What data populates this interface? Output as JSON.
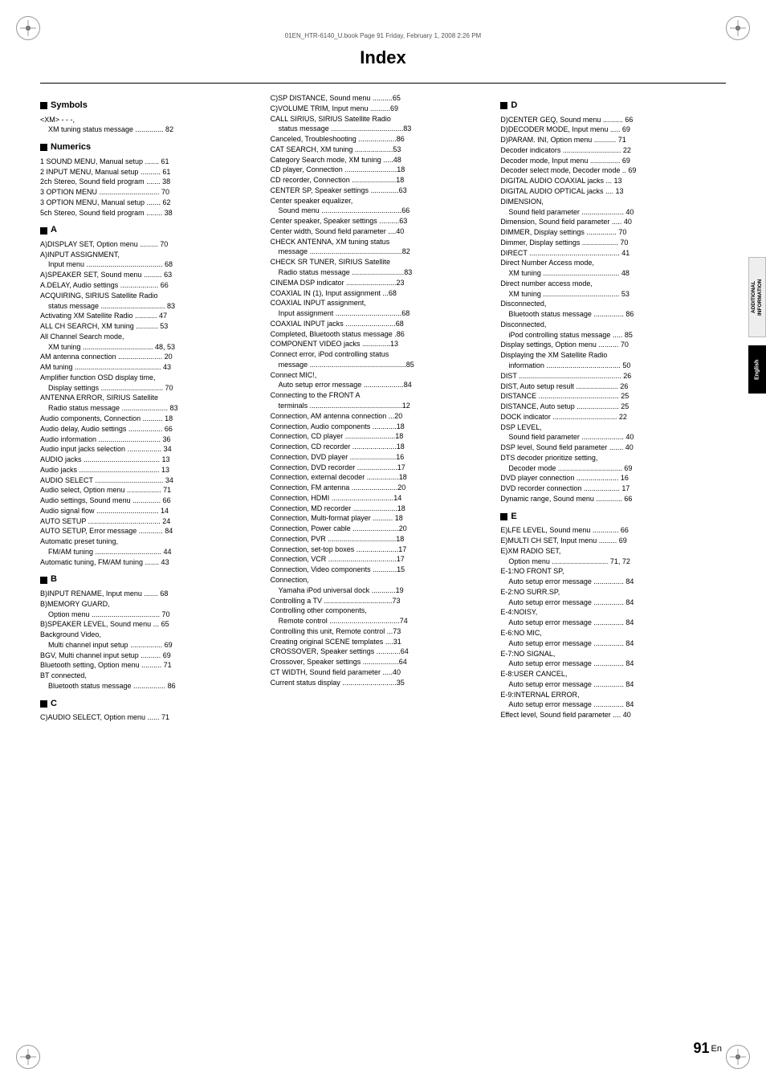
{
  "page": {
    "title": "Index",
    "file_info": "01EN_HTR-6140_U.book  Page 91  Friday, February 1, 2008  2:26 PM",
    "page_number": "91",
    "page_lang": "En"
  },
  "side_tabs": {
    "additional_info": "ADDITIONAL\nINFORMATION",
    "english": "English"
  },
  "columns": {
    "col1": {
      "sections": [
        {
          "header": "Symbols",
          "entries": [
            "<XM> - - -,",
            "  XM tuning status message .............. 82"
          ]
        },
        {
          "header": "Numerics",
          "entries": [
            "1 SOUND MENU, Manual setup ....... 61",
            "2 INPUT MENU, Manual setup .......... 61",
            "2ch Stereo, Sound field program ....... 38",
            "3 OPTION MENU .............................. 70",
            "3 OPTION MENU, Manual setup ....... 62",
            "5ch Stereo, Sound field program ........ 38"
          ]
        },
        {
          "header": "A",
          "entries": [
            "A)DISPLAY SET, Option menu ......... 70",
            "A)INPUT ASSIGNMENT,",
            "  Input menu ...................................... 68",
            "A)SPEAKER SET, Sound menu ......... 63",
            "A.DELAY, Audio settings ..................... 66",
            "ACQUIRING, SIRIUS Satellite Radio",
            "  status message ................................ 83",
            "Activating XM Satellite Radio ........... 47",
            "ALL CH SEARCH, XM tuning ........... 53",
            "All Channel Search mode,",
            "  XM tuning ................................... 48, 53",
            "AM antenna connection ...................... 20",
            "AM tuning ........................................... 43",
            "Amplifier function OSD display time,",
            "  Display settings ............................... 70",
            "ANTENNA ERROR, SIRIUS Satellite",
            "  Radio status message ....................... 83",
            "Audio components, Connection .......... 18",
            "Audio delay, Audio settings ................. 66",
            "Audio information ............................... 36",
            "Audio input jacks selection ................. 34",
            "AUDIO jacks ...................................... 13",
            "Audio jacks ........................................ 13",
            "AUDIO SELECT .................................. 34",
            "Audio select, Option menu ................. 71",
            "Audio settings, Sound menu .............. 66",
            "Audio signal flow ............................... 14",
            "AUTO SETUP .................................... 24",
            "AUTO SETUP, Error message ............ 84",
            "Automatic preset tuning,",
            "  FM/AM tuning ................................. 44",
            "Automatic tuning, FM/AM tuning ....... 43"
          ]
        },
        {
          "header": "B",
          "entries": [
            "B)INPUT RENAME, Input menu ....... 68",
            "B)MEMORY GUARD,",
            "  Option menu .................................. 70",
            "B)SPEAKER LEVEL, Sound menu ... 65",
            "Background Video,",
            "  Multi channel input setup ................ 69",
            "BGV, Multi channel input setup .......... 69",
            "Bluetooth setting, Option menu .......... 71",
            "BT connected,",
            "  Bluetooth status message ................ 86"
          ]
        },
        {
          "header": "C",
          "entries": [
            "C)AUDIO SELECT, Option menu ...... 71"
          ]
        }
      ]
    },
    "col2": {
      "entries": [
        "C)SP DISTANCE, Sound menu ..........65",
        "C)VOLUME TRIM, Input menu ..........69",
        "CALL SIRIUS, SIRIUS Satellite Radio",
        "  status message ....................................83",
        "Canceled, Troubleshooting ...................86",
        "CAT SEARCH, XM tuning ...................53",
        "Category Search mode, XM tuning .....48",
        "CD player, Connection ..........................18",
        "CD recorder, Connection ......................18",
        "CENTER SP, Speaker settings ..............63",
        "Center speaker equalizer,",
        "  Sound menu ........................................66",
        "Center speaker, Speaker settings ..........63",
        "Center width, Sound field parameter ....40",
        "CHECK ANTENNA, XM tuning status",
        "  message ..............................................82",
        "CHECK SR TUNER, SIRIUS Satellite",
        "  Radio status message ..........................83",
        "CINEMA DSP indicator .........................23",
        "COAXIAL IN (1), Input assignment ...68",
        "COAXIAL INPUT assignment,",
        "  Input assignment .................................68",
        "COAXIAL INPUT jacks .........................68",
        "Completed, Bluetooth status message .86",
        "COMPONENT VIDEO jacks ..............13",
        "Connect error, iPod controlling status",
        "  message ................................................85",
        "Connect MIC!,",
        "  Auto setup error message ....................84",
        "Connecting to the FRONT A",
        "  terminals ..............................................12",
        "Connection, AM antenna connection ...20",
        "Connection, Audio components ............18",
        "Connection, CD player .........................18",
        "Connection, CD recorder ......................18",
        "Connection, DVD player .......................16",
        "Connection, DVD recorder ....................17",
        "Connection, external decoder ................18",
        "Connection, FM antenna .......................20",
        "Connection, HDMI ...............................14",
        "Connection, MD recorder ......................18",
        "Connection, Multi-format player .......... 18",
        "Connection, Power cable .......................20",
        "Connection, PVR ..................................18",
        "Connection, set-top boxes .....................17",
        "Connection, VCR ..................................17",
        "Connection, Video components ............15",
        "Connection,",
        "  Yamaha iPod universal dock ............19",
        "Controlling a TV ..................................73",
        "Controlling other components,",
        "  Remote control ...................................74",
        "Controlling this unit, Remote control ...73",
        "Creating original SCENE templates ....31",
        "CROSSOVER, Speaker settings ............64",
        "Crossover, Speaker settings ..................64",
        "CT WIDTH, Sound field parameter .....40",
        "Current status display ...........................35"
      ]
    },
    "col3": {
      "sections": [
        {
          "header": "D",
          "entries": [
            "D)CENTER GEQ, Sound menu .......... 66",
            "D)DECODER MODE, Input menu ..... 69",
            "D)PARAM. INI, Option menu ........... 71",
            "Decoder indicators ............................. 22",
            "Decoder mode, Input menu ............... 69",
            "Decoder select mode, Decoder mode .. 69",
            "DIGITAL AUDIO COAXIAL jacks ... 13",
            "DIGITAL AUDIO OPTICAL jacks .... 13",
            "DIMENSION,",
            "  Sound field parameter ..................... 40",
            "Dimension, Sound field parameter ..... 40",
            "DIMMER, Display settings ............... 70",
            "Dimmer, Display settings .................. 70",
            "DIRECT ............................................. 41",
            "Direct Number Access mode,",
            "  XM tuning ...................................... 48",
            "Direct number access mode,",
            "  XM tuning ...................................... 53",
            "Disconnected,",
            "  Bluetooth status message ............... 86",
            "Disconnected,",
            "  iPod controlling status message ..... 85",
            "Display settings, Option menu .......... 70",
            "Displaying the XM Satellite Radio",
            "  information ..................................... 50",
            "DIST ................................................... 26",
            "DIST, Auto setup result ..................... 26",
            "DISTANCE ........................................ 25",
            "DISTANCE, Auto setup ..................... 25",
            "DOCK indicator ................................ 22",
            "DSP LEVEL,",
            "  Sound field parameter ..................... 40",
            "DSP level, Sound field parameter ....... 40",
            "DTS decoder prioritize setting,",
            "  Decoder mode ................................ 69",
            "DVD player connection ..................... 16",
            "DVD recorder connection .................. 17",
            "Dynamic range, Sound menu ............. 66"
          ]
        },
        {
          "header": "E",
          "entries": [
            "E)LFE LEVEL, Sound menu ............. 66",
            "E)MULTI CH SET, Input menu ......... 69",
            "E)XM RADIO SET,",
            "  Option menu ............................ 71, 72",
            "E-1:NO FRONT SP,",
            "  Auto setup error message ............... 84",
            "E-2:NO SURR.SP,",
            "  Auto setup error message ............... 84",
            "E-4:NOISY,",
            "  Auto setup error message ............... 84",
            "E-6:NO MIC,",
            "  Auto setup error message ............... 84",
            "E-7:NO SIGNAL,",
            "  Auto setup error message ............... 84",
            "E-8:USER CANCEL,",
            "  Auto setup error message ............... 84",
            "E-9:INTERNAL ERROR,",
            "  Auto setup error message ............... 84",
            "Effect level, Sound field parameter .... 40"
          ]
        }
      ]
    }
  }
}
